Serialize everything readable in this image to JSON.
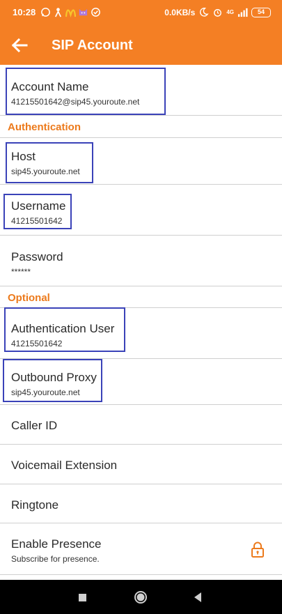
{
  "status_bar": {
    "time": "10:28",
    "speed": "0.0KB/s",
    "network": "4G",
    "battery": "54"
  },
  "app_bar": {
    "title": "SIP Account"
  },
  "account": {
    "label": "Account Name",
    "value": "41215501642@sip45.youroute.net"
  },
  "sections": {
    "authentication": "Authentication",
    "optional": "Optional"
  },
  "auth": {
    "host_label": "Host",
    "host_value": "sip45.youroute.net",
    "username_label": "Username",
    "username_value": "41215501642",
    "password_label": "Password",
    "password_value": "******"
  },
  "optional": {
    "auth_user_label": "Authentication User",
    "auth_user_value": "41215501642",
    "proxy_label": "Outbound Proxy",
    "proxy_value": "sip45.youroute.net",
    "caller_id_label": "Caller ID",
    "voicemail_label": "Voicemail Extension",
    "ringtone_label": "Ringtone",
    "presence_label": "Enable Presence",
    "presence_value": "Subscribe for presence."
  },
  "colors": {
    "accent": "#f47f24",
    "section_text": "#ec7a1c",
    "highlight_box": "#3a42b8"
  },
  "icons": {
    "back": "arrow-left-icon",
    "presence_lock": "lock-icon",
    "nav_recents": "square-icon",
    "nav_home": "circle-icon",
    "nav_back": "triangle-back-icon"
  }
}
